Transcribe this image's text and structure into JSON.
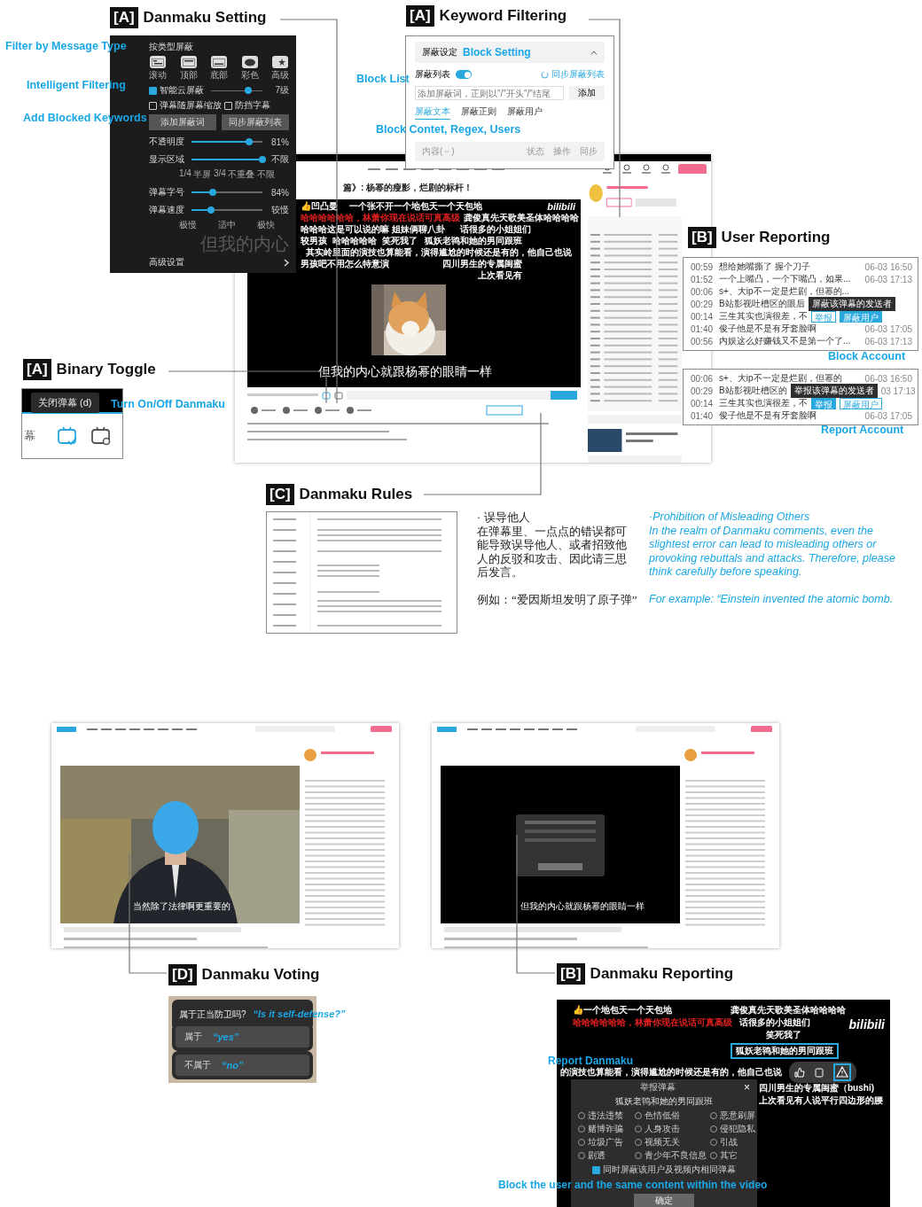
{
  "setting": {
    "tag": "[A]",
    "title": "Danmaku Setting",
    "annotations": [
      "Filter by Message Type",
      "Intelligent Filtering",
      "Add Blocked Keywords"
    ],
    "type_heading": "按类型屏蔽",
    "types": [
      {
        "kind": "scroll",
        "label": "滚动"
      },
      {
        "kind": "top",
        "label": "顶部"
      },
      {
        "kind": "bottom",
        "label": "底部"
      },
      {
        "kind": "color",
        "label": "彩色"
      },
      {
        "kind": "advanced",
        "label": "高级"
      }
    ],
    "smart": {
      "label": "智能云屏蔽",
      "checked": true,
      "level": 0.72,
      "reading": "7级"
    },
    "options": [
      {
        "label": "弹幕随屏幕缩放",
        "checked": false
      },
      {
        "label": "防挡字幕",
        "checked": false
      }
    ],
    "buttons": [
      "添加屏蔽词",
      "同步屏蔽列表"
    ],
    "sliders": [
      {
        "label": "不透明度",
        "level": 0.81,
        "reading": "81%"
      },
      {
        "label": "显示区域",
        "level": 1,
        "reading": "不限",
        "ticks": [
          "1/4",
          "半屏",
          "3/4",
          "不重叠",
          "不限"
        ]
      },
      {
        "label": "弹幕字号",
        "level": 0.3,
        "reading": "84%"
      },
      {
        "label": "弹幕速度",
        "level": 0.27,
        "reading": "较慢",
        "ticks": [
          "极慢",
          "适中",
          "极快"
        ]
      }
    ],
    "backdrop_text": "但我的内心",
    "advanced": "高级设置"
  },
  "keyword": {
    "tag": "[A]",
    "title": "Keyword Filtering",
    "header": "屏蔽设定",
    "header_note": "Block Setting",
    "list_label": "屏蔽列表",
    "list_on": true,
    "sync": "同步屏蔽列表",
    "placeholder": "添加屏蔽词，正则以\"/\"开头\"/\"结尾",
    "add": "添加",
    "tabs": [
      {
        "label": "屏蔽文本",
        "selected": true
      },
      {
        "label": "屏蔽正则",
        "selected": false
      },
      {
        "label": "屏蔽用户",
        "selected": false
      }
    ],
    "columns": [
      "内容(－)",
      "状态",
      "操作",
      "同步"
    ],
    "annotations": [
      "Block List",
      "Block Contet, Regex, Users"
    ]
  },
  "main": {
    "title": "篇》: 杨幂的瘦影，烂剧的标杆！",
    "danmaku": [
      {
        "text": "👍凹凸曼",
        "color": "#ffffff"
      },
      {
        "text": "一个张不开一个地包天一个天包地",
        "color": "#ffffff"
      },
      {
        "text": "哈哈哈哈哈哈，林萧你现在说话可真高级",
        "color": "#e02020"
      },
      {
        "text": "龚俊真先天歌美圣体哈哈哈哈",
        "color": "#ffffff"
      },
      {
        "text": "哈哈哈这是可以说的嘛 姐妹俩聊八卦",
        "color": "#ffffff"
      },
      {
        "text": "话很多的小姐姐们",
        "color": "#ffffff"
      },
      {
        "text": "较男孩",
        "color": "#ffffff"
      },
      {
        "text": "哈哈哈哈哈",
        "color": "#ffffff"
      },
      {
        "text": "笑死我了",
        "color": "#ffffff"
      },
      {
        "text": "狐妖老鸨和她的男同跟班",
        "color": "#ffffff"
      },
      {
        "text": "其实岭里面的演技也算能看，演得尴尬的时候还是有的，他自己也说",
        "color": "#ffffff"
      },
      {
        "text": "男孩吧不用怎么特意演",
        "color": "#ffffff"
      },
      {
        "text": "四川男生的专属闺蜜",
        "color": "#ffffff"
      },
      {
        "text": "上次看见有",
        "color": "#ffffff"
      }
    ],
    "logo": "bilibili",
    "subtitle": "但我的内心就跟杨幂的眼睛一样"
  },
  "reporting": {
    "tag": "[B]",
    "title": "User Reporting",
    "block_rows": [
      {
        "time": "00:59",
        "text": "想给她嘴撕了 握个刀子",
        "date": "06-03 16:50"
      },
      {
        "time": "01:52",
        "text": "一个上嘴凸，一个下嘴凸，如果...",
        "date": "06-03 17:13"
      },
      {
        "time": "00:06",
        "text": "s+、大ip不一定是烂剧，但幂的..."
      },
      {
        "time": "00:29",
        "text": "B站影视吐槽区的眼后",
        "tooltip": "屏蔽该弹幕的发送者"
      },
      {
        "time": "00:14",
        "text": "三生其实也演很差，不",
        "actions": [
          {
            "label": "举报",
            "selected": false
          },
          {
            "label": "屏蔽用户",
            "selected": true
          }
        ]
      },
      {
        "time": "01:40",
        "text": "俊子他是不是有牙套脸啊",
        "date": "06-03 17:05"
      },
      {
        "time": "00:56",
        "text": "内娱这么好赚钱又不是第一个了...",
        "date": "06-03 17:13"
      }
    ],
    "block_note": "Block Account",
    "report_rows": [
      {
        "time": "00:06",
        "text": "s+、大ip不一定是烂剧，但幂的",
        "date": "06-03 16:50"
      },
      {
        "time": "00:29",
        "text": "B站影视吐槽区的",
        "tooltip": "举报该弹幕的发送者",
        "date": "03 17:13"
      },
      {
        "time": "00:14",
        "text": "三生其实也演很差，不",
        "actions": [
          {
            "label": "举报",
            "selected": true
          },
          {
            "label": "屏蔽用户",
            "selected": false
          }
        ]
      },
      {
        "time": "01:40",
        "text": "俊子他是不是有牙套脸啊",
        "date": "06-03 17:05"
      }
    ],
    "report_note": "Report Account"
  },
  "toggle": {
    "tag": "[A]",
    "title": "Binary Toggle",
    "tooltip": "关闭弹幕 (d)",
    "note": "Turn On/Off Danmaku",
    "side_text": "幕",
    "on": true
  },
  "rules": {
    "tag": "[C]",
    "title": "Danmaku Rules",
    "zh_heading": "· 误导他人",
    "zh_body": "在弹幕里、一点点的错误都可能导致误导他人、或者招致他人的反驳和攻击、因此请三思后发言。",
    "zh_example": "例如：“爱因斯坦发明了原子弹”",
    "en_heading": "·Prohibition of Misleading Others",
    "en_body": "In the realm of Danmaku comments, even the slightest error can lead to misleading others or provoking rebuttals and attacks. Therefore, please think carefully before speaking.",
    "en_example": "For example: “Einstein invented the atomic bomb."
  },
  "screens": [
    {
      "kind": "person",
      "subtitle": "当然除了法律啊更重要的"
    },
    {
      "kind": "dark",
      "subtitle": "但我的内心就跟杨幂的眼睛一样"
    }
  ],
  "voting": {
    "tag": "[D]",
    "title": "Danmaku Voting",
    "question": "属于正当防卫吗?",
    "question_note": "“Is it self-defense?”",
    "options": [
      {
        "label": "属于",
        "note": "“yes”"
      },
      {
        "label": "不属于",
        "note": "“no”"
      }
    ]
  },
  "danmaku_report": {
    "tag": "[B]",
    "title": "Danmaku Reporting",
    "danmaku": [
      {
        "text": "👍一个地包天一个天包地",
        "color": "#ffffff",
        "highlight": false
      },
      {
        "text": "龚俊真先天歌美圣体哈哈哈哈",
        "color": "#ffffff",
        "highlight": false
      },
      {
        "text": "哈哈哈哈哈哈，林萧你现在说话可真高级",
        "color": "#e02020",
        "highlight": false
      },
      {
        "text": "话很多的小姐姐们",
        "color": "#ffffff",
        "highlight": false
      },
      {
        "text": "笑死我了",
        "color": "#ffffff",
        "highlight": false
      },
      {
        "text": "狐妖老鸨和她的男同跟班",
        "color": "#ffffff",
        "highlight": true
      },
      {
        "text": "的演技也算能看，演得尴尬的时候还是有的，他自己也说",
        "color": "#ffffff",
        "highlight": false
      },
      {
        "text": "四川男生的专属闺蜜（bushi)",
        "color": "#ffffff",
        "highlight": false
      },
      {
        "text": "上次看见有人说平行四边形的腰",
        "color": "#ffffff",
        "highlight": false
      }
    ],
    "logo": "bilibili",
    "note": "Report Danmaku",
    "dialog_title": "举报弹幕",
    "close": "×",
    "target": "狐妖老鸨和她的男同跟班",
    "reasons": [
      {
        "label": "违法违禁",
        "selected": false
      },
      {
        "label": "色情低俗",
        "selected": false
      },
      {
        "label": "恶意刷屏",
        "selected": false
      },
      {
        "label": "赌博诈骗",
        "selected": false
      },
      {
        "label": "人身攻击",
        "selected": false
      },
      {
        "label": "侵犯隐私",
        "selected": false
      },
      {
        "label": "垃圾广告",
        "selected": false
      },
      {
        "label": "视频无关",
        "selected": false
      },
      {
        "label": "引战",
        "selected": false
      },
      {
        "label": "剧透",
        "selected": false
      },
      {
        "label": "青少年不良信息",
        "selected": false
      },
      {
        "label": "其它",
        "selected": false
      }
    ],
    "block_same": {
      "label": "同时屏蔽该用户及视频内相同弹幕",
      "checked": true
    },
    "block_note": "Block the user and the same content within the video",
    "confirm": "确定"
  }
}
